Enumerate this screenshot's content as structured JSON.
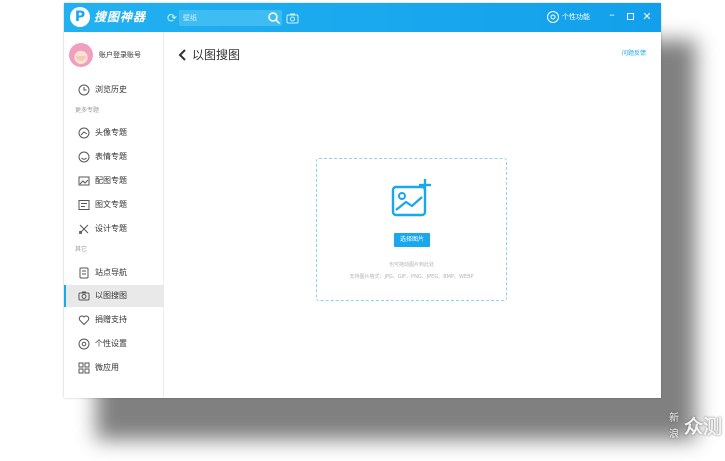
{
  "app": {
    "name": "搜图神器",
    "logo_letter": "P"
  },
  "header": {
    "search": {
      "placeholder": "壁纸"
    },
    "personal_center": "个性功能"
  },
  "sidebar": {
    "account": "账户登录账号",
    "primary": [
      {
        "label": "浏览历史",
        "icon": "history-icon"
      }
    ],
    "sections": [
      {
        "title": "更多专题",
        "items": [
          {
            "label": "头像专题",
            "icon": "avatar-topic-icon"
          },
          {
            "label": "表情专题",
            "icon": "emoji-icon"
          },
          {
            "label": "配图专题",
            "icon": "picture-icon"
          },
          {
            "label": "图文专题",
            "icon": "text-image-icon"
          },
          {
            "label": "设计专题",
            "icon": "design-icon"
          }
        ]
      },
      {
        "title": "其它",
        "items": [
          {
            "label": "站点导航",
            "icon": "site-nav-icon"
          },
          {
            "label": "以图搜图",
            "icon": "camera-icon",
            "active": true
          },
          {
            "label": "捐赠支持",
            "icon": "heart-icon"
          },
          {
            "label": "个性设置",
            "icon": "settings-icon"
          },
          {
            "label": "微应用",
            "icon": "apps-icon"
          }
        ]
      }
    ]
  },
  "main": {
    "title": "以图搜图",
    "feedback": "问题反馈",
    "upload": {
      "button": "选择图片",
      "hint_line1": "也可拖动图片到此处",
      "hint_line2": "支持图片格式：JPG、GIF、PNG、JPEG、BMP、WEBP"
    }
  },
  "watermark": {
    "small_top": "新",
    "small_bottom": "浪",
    "big": "众测"
  },
  "colors": {
    "accent": "#19a8ee",
    "titlebar": "#16a6ee",
    "active_row": "#e9e9e9"
  }
}
